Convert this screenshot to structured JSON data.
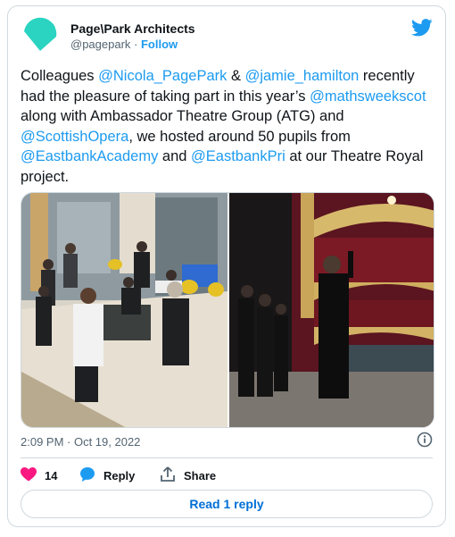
{
  "author": {
    "name": "Page\\Park Architects",
    "handle": "@pagepark",
    "separator": " · ",
    "follow_label": "Follow"
  },
  "tweet": {
    "p1": "Colleagues ",
    "m1": "@Nicola_PagePark",
    "p2": " & ",
    "m2": "@jamie_hamilton",
    "p3": " recently had the pleasure of taking part in this year’s ",
    "m3": "@mathsweekscot",
    "p4": " along with Ambassador Theatre Group (ATG) and ",
    "m4": "@ScottishOpera",
    "p5": ", we hosted around 50 pupils from ",
    "m5": "@EastbankAcademy",
    "p6": " and ",
    "m6": "@EastbankPri",
    "p7": " at our Theatre Royal project."
  },
  "timestamp": "2:09 PM · Oct 19, 2022",
  "actions": {
    "like_count": "14",
    "reply_label": "Reply",
    "share_label": "Share"
  },
  "read_replies_label": "Read 1 reply",
  "icons": {
    "logo": "pagepark-logo-icon",
    "platform": "twitter-bird-icon",
    "info": "info-icon",
    "like": "heart-icon",
    "reply": "reply-bubble-icon",
    "share": "share-icon"
  },
  "colors": {
    "accent": "#1d9bf0",
    "heart": "#f91880",
    "logo_teal": "#2ad4c1",
    "muted": "#536471"
  }
}
